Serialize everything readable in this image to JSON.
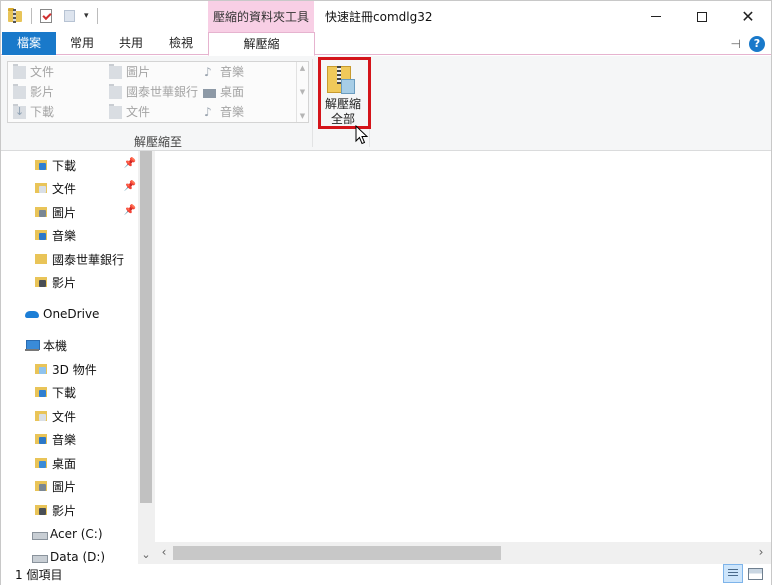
{
  "window": {
    "title": "快速註冊comdlg32",
    "context_tab_group": "壓縮的資料夾工具"
  },
  "ribbon_tabs": [
    {
      "label": "檔案"
    },
    {
      "label": "常用"
    },
    {
      "label": "共用"
    },
    {
      "label": "檢視"
    },
    {
      "label": "解壓縮"
    }
  ],
  "ribbon": {
    "gallery_items": [
      {
        "label": "文件",
        "icon": "documents-icon"
      },
      {
        "label": "圖片",
        "icon": "pictures-icon"
      },
      {
        "label": "音樂",
        "icon": "music-icon"
      },
      {
        "label": "影片",
        "icon": "videos-icon"
      },
      {
        "label": "國泰世華銀行",
        "icon": "folder-icon"
      },
      {
        "label": "桌面",
        "icon": "desktop-icon"
      },
      {
        "label": "下載",
        "icon": "downloads-icon"
      },
      {
        "label": "文件",
        "icon": "documents-icon"
      },
      {
        "label": "音樂",
        "icon": "music-icon"
      }
    ],
    "group_label": "解壓縮至",
    "extract_all_line1": "解壓縮",
    "extract_all_line2": "全部",
    "highlight_color": "#d4141a"
  },
  "nav_items": [
    {
      "label": "下載",
      "icon": "downloads-folder-icon",
      "pinned": true
    },
    {
      "label": "文件",
      "icon": "documents-folder-icon",
      "pinned": true
    },
    {
      "label": "圖片",
      "icon": "pictures-folder-icon",
      "pinned": true
    },
    {
      "label": "音樂",
      "icon": "music-folder-icon",
      "pinned": false
    },
    {
      "label": "國泰世華銀行",
      "icon": "folder-icon",
      "pinned": false
    },
    {
      "label": "影片",
      "icon": "videos-folder-icon",
      "pinned": false
    },
    {
      "label": "OneDrive",
      "icon": "onedrive-icon",
      "pinned": false
    },
    {
      "label": "本機",
      "icon": "this-pc-icon",
      "pinned": false
    },
    {
      "label": "3D 物件",
      "icon": "3d-objects-folder-icon",
      "pinned": false
    },
    {
      "label": "下載",
      "icon": "downloads-folder-icon",
      "pinned": false
    },
    {
      "label": "文件",
      "icon": "documents-folder-icon",
      "pinned": false
    },
    {
      "label": "音樂",
      "icon": "music-folder-icon",
      "pinned": false
    },
    {
      "label": "桌面",
      "icon": "desktop-folder-icon",
      "pinned": false
    },
    {
      "label": "圖片",
      "icon": "pictures-folder-icon",
      "pinned": false
    },
    {
      "label": "影片",
      "icon": "videos-folder-icon",
      "pinned": false
    },
    {
      "label": "Acer (C:)",
      "icon": "drive-c-icon",
      "pinned": false
    },
    {
      "label": "Data (D:)",
      "icon": "drive-d-icon",
      "pinned": false
    }
  ],
  "status": {
    "item_count": "1 個項目"
  },
  "colors": {
    "file_tab": "#1979ca",
    "context_tab": "#f8cfe5",
    "folder": "#e9c458"
  }
}
